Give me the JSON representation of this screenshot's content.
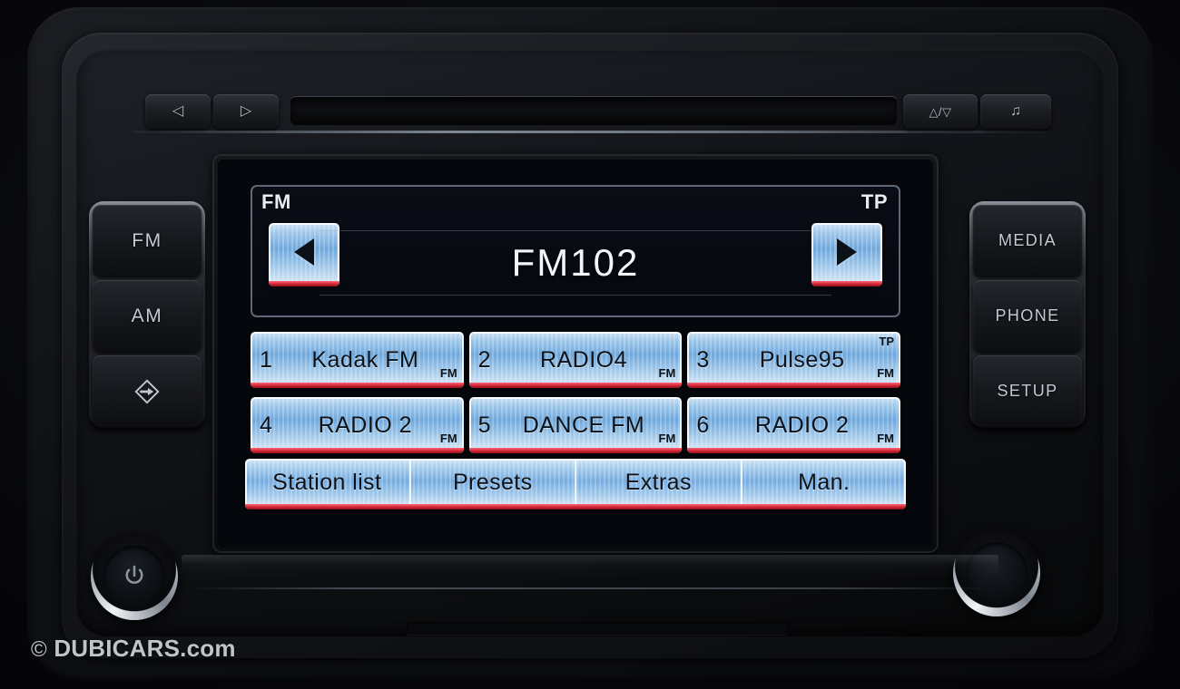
{
  "unit": {
    "top_strip": {
      "prev_label": "◁",
      "next_label": "▷",
      "updown_label": "△/▽",
      "music_label": "♫",
      "cd_slot_name": "cd-slot"
    },
    "left_buttons": [
      {
        "label": "FM",
        "name": "fm-band-button"
      },
      {
        "label": "AM",
        "name": "am-band-button"
      },
      {
        "label": "",
        "name": "traffic-announce-button"
      }
    ],
    "right_buttons": [
      {
        "label": "MEDIA",
        "name": "media-button"
      },
      {
        "label": "PHONE",
        "name": "phone-button"
      },
      {
        "label": "SETUP",
        "name": "setup-button"
      }
    ],
    "knobs": {
      "power_label": "⏻",
      "power_name": "power-volume-knob",
      "tune_name": "tune-select-knob"
    }
  },
  "screen": {
    "status": {
      "band": "FM",
      "traffic": "TP"
    },
    "tuner": {
      "frequency": "FM102",
      "seek_down": "◀",
      "seek_up": "▶"
    },
    "presets": [
      {
        "number": "1",
        "name": "Kadak FM",
        "band": "FM",
        "tp": ""
      },
      {
        "number": "2",
        "name": "RADIO4",
        "band": "FM",
        "tp": ""
      },
      {
        "number": "3",
        "name": "Pulse95",
        "band": "FM",
        "tp": "TP"
      },
      {
        "number": "4",
        "name": "RADIO 2",
        "band": "FM",
        "tp": ""
      },
      {
        "number": "5",
        "name": "DANCE FM",
        "band": "FM",
        "tp": ""
      },
      {
        "number": "6",
        "name": "RADIO 2",
        "band": "FM",
        "tp": ""
      }
    ],
    "menu": [
      {
        "label": "Station list"
      },
      {
        "label": "Presets"
      },
      {
        "label": "Extras"
      },
      {
        "label": "Man."
      }
    ]
  },
  "watermark": {
    "symbol": "©",
    "text": "DUBICARS.com"
  },
  "colors": {
    "lcd_key_blue": "#76ace0",
    "lcd_key_underline_red": "#d32434",
    "screen_background": "#05070d",
    "button_text": "#c4c9d1",
    "lcd_text": "#0c1219",
    "status_text": "#e8edf4"
  }
}
